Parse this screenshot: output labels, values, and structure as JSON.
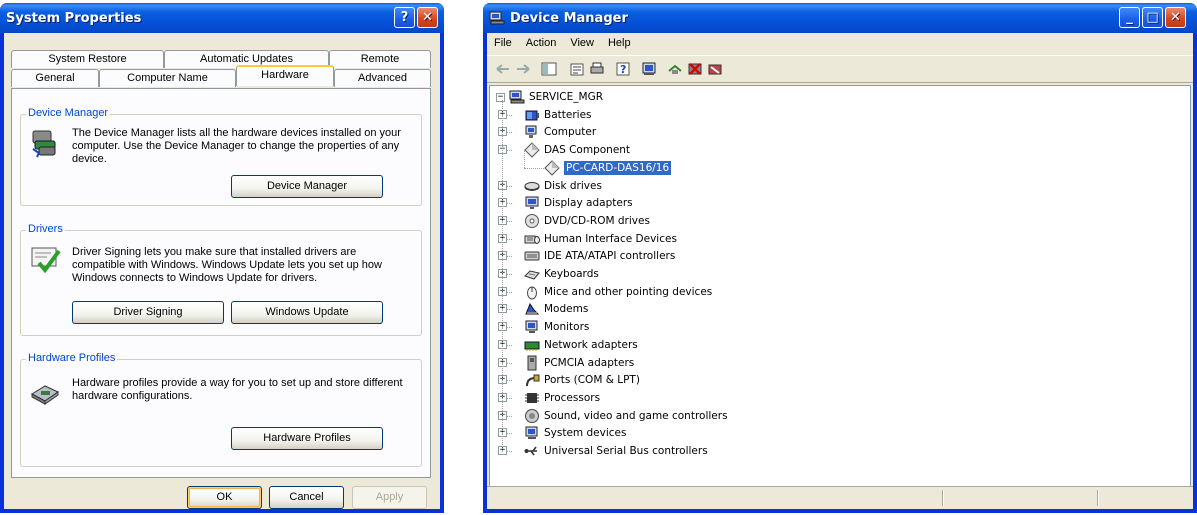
{
  "system_properties": {
    "title": "System Properties",
    "tabs_row1": [
      "System Restore",
      "Automatic Updates",
      "Remote"
    ],
    "tabs_row2": [
      "General",
      "Computer Name",
      "Hardware",
      "Advanced"
    ],
    "active_tab": "Hardware",
    "device_manager_group": {
      "legend": "Device Manager",
      "text": "The Device Manager lists all the hardware devices installed on your computer. Use the Device Manager to change the properties of any device.",
      "button": "Device Manager"
    },
    "drivers_group": {
      "legend": "Drivers",
      "text": "Driver Signing lets you make sure that installed drivers are compatible with Windows. Windows Update lets you set up how Windows connects to Windows Update for drivers.",
      "button_signing": "Driver Signing",
      "button_update": "Windows Update"
    },
    "profiles_group": {
      "legend": "Hardware Profiles",
      "text": "Hardware profiles provide a way for you to set up and store different hardware configurations.",
      "button": "Hardware Profiles"
    },
    "ok": "OK",
    "cancel": "Cancel",
    "apply": "Apply"
  },
  "device_manager": {
    "title": "Device Manager",
    "menu": [
      "File",
      "Action",
      "View",
      "Help"
    ],
    "root": "SERVICE_MGR",
    "items": [
      {
        "label": "Batteries",
        "icon": "battery-icon"
      },
      {
        "label": "Computer",
        "icon": "computer-icon"
      },
      {
        "label": "DAS Component",
        "icon": "diamond-icon",
        "expanded": true,
        "children": [
          {
            "label": "PC-CARD-DAS16/16",
            "icon": "diamond-icon",
            "selected": true
          }
        ]
      },
      {
        "label": "Disk drives",
        "icon": "disk-icon"
      },
      {
        "label": "Display adapters",
        "icon": "display-icon"
      },
      {
        "label": "DVD/CD-ROM drives",
        "icon": "cdrom-icon"
      },
      {
        "label": "Human Interface Devices",
        "icon": "hid-icon"
      },
      {
        "label": "IDE ATA/ATAPI controllers",
        "icon": "ide-icon"
      },
      {
        "label": "Keyboards",
        "icon": "keyboard-icon"
      },
      {
        "label": "Mice and other pointing devices",
        "icon": "mouse-icon"
      },
      {
        "label": "Modems",
        "icon": "modem-icon"
      },
      {
        "label": "Monitors",
        "icon": "monitor-icon"
      },
      {
        "label": "Network adapters",
        "icon": "network-icon"
      },
      {
        "label": "PCMCIA adapters",
        "icon": "pcmcia-icon"
      },
      {
        "label": "Ports (COM & LPT)",
        "icon": "port-icon"
      },
      {
        "label": "Processors",
        "icon": "processor-icon"
      },
      {
        "label": "Sound, video and game controllers",
        "icon": "sound-icon"
      },
      {
        "label": "System devices",
        "icon": "system-icon"
      },
      {
        "label": "Universal Serial Bus controllers",
        "icon": "usb-icon"
      }
    ]
  }
}
